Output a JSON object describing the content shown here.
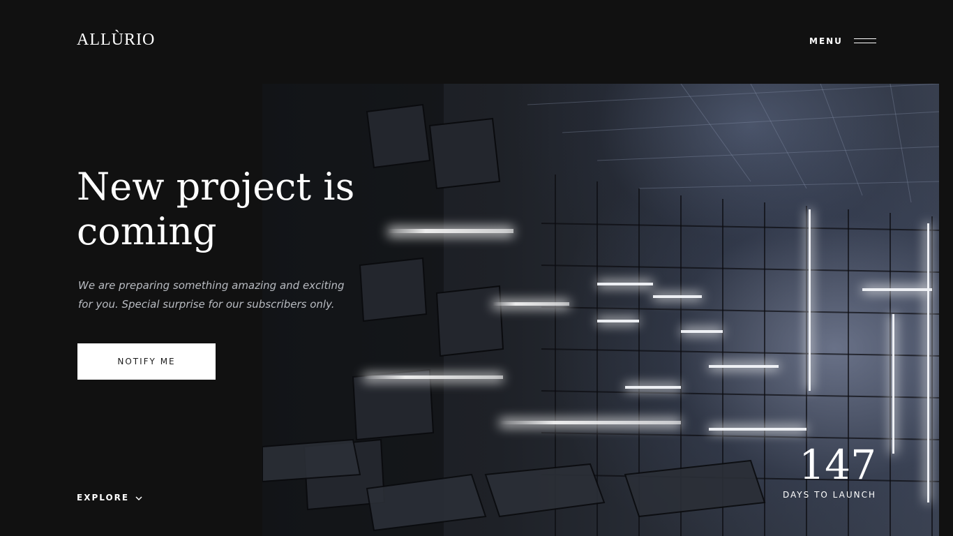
{
  "brand": {
    "logo_text": "ALLÙRIO"
  },
  "header": {
    "menu_label": "MENU",
    "menu_icon": "hamburger-icon"
  },
  "hero": {
    "headline": "New project is coming",
    "subtitle": "We are preparing something amazing and exciting for you. Special surprise for our subscribers only.",
    "cta_label": "NOTIFY ME",
    "image_description_icon": "cube-corridor-image"
  },
  "footer": {
    "explore_label": "EXPLORE",
    "explore_icon": "chevron-down-icon"
  },
  "countdown": {
    "days": "147",
    "label": "DAYS TO LAUNCH"
  },
  "colors": {
    "background": "#111111",
    "text": "#ffffff",
    "subtitle": "#b9bcc2",
    "button_bg": "#ffffff",
    "button_text": "#1a1a1a"
  }
}
